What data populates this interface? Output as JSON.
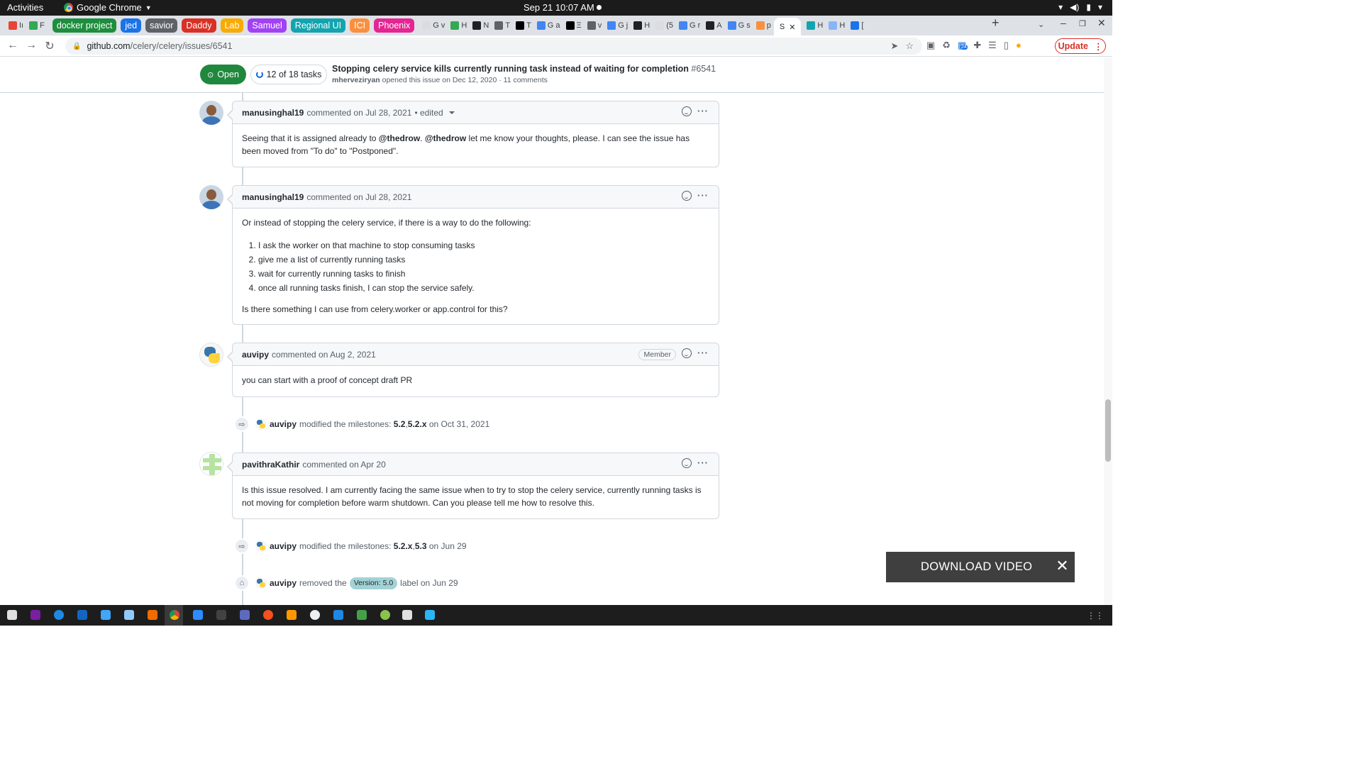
{
  "system": {
    "activities": "Activities",
    "app_name": "Google Chrome",
    "clock": "Sep 21  10:07 AM"
  },
  "tab_groups": [
    {
      "label": "docker project",
      "color": "#1e8e3e"
    },
    {
      "label": "jed",
      "color": "#1a73e8"
    },
    {
      "label": "savior",
      "color": "#5f6368"
    },
    {
      "label": "Daddy",
      "color": "#d93025"
    },
    {
      "label": "Lab",
      "color": "#f9ab00"
    },
    {
      "label": "Samuel",
      "color": "#a142f4"
    },
    {
      "label": "Regional UI",
      "color": "#12a4af"
    },
    {
      "label": "ICI",
      "color": "#fa903e"
    },
    {
      "label": "Phoenix",
      "color": "#e52592"
    }
  ],
  "pre_tabs": [
    {
      "label": "Iı",
      "fav": "#ea4335"
    },
    {
      "label": "F",
      "fav": "#34a853"
    }
  ],
  "mini_tabs": [
    {
      "label": "G v",
      "fav": "#dadce0"
    },
    {
      "label": "H",
      "fav": "#34a853"
    },
    {
      "label": "N",
      "fav": "#202124"
    },
    {
      "label": "T",
      "fav": "#5f6368"
    },
    {
      "label": "T",
      "fav": "#000000"
    },
    {
      "label": "G a",
      "fav": "#4285f4"
    },
    {
      "label": "Ξ",
      "fav": "#000000"
    },
    {
      "label": "v",
      "fav": "#5f6368"
    },
    {
      "label": "G j",
      "fav": "#4285f4"
    },
    {
      "label": "H",
      "fav": "#202124"
    },
    {
      "label": "(5",
      "fav": "#dadce0"
    },
    {
      "label": "G r",
      "fav": "#4285f4"
    },
    {
      "label": "A",
      "fav": "#202124"
    },
    {
      "label": "G s",
      "fav": "#4285f4"
    },
    {
      "label": "p",
      "fav": "#fa903e"
    }
  ],
  "active_tab": {
    "label": "S",
    "close": "✕"
  },
  "post_tabs": [
    {
      "label": "H",
      "fav": "#12a4af"
    },
    {
      "label": "H",
      "fav": "#8ab4f8"
    },
    {
      "label": "[",
      "fav": "#1a73e8"
    }
  ],
  "browser": {
    "url_host": "github.com",
    "url_path": "/celery/celery/issues/6541",
    "update_label": "Update",
    "ext_badge": "24"
  },
  "issue": {
    "state": "Open",
    "tasks": "12 of 18 tasks",
    "title": "Stopping celery service kills currently running task instead of waiting for completion",
    "number": "#6541",
    "author": "mherveziryan",
    "meta": "opened this issue on Dec 12, 2020 · 11 comments"
  },
  "comments": [
    {
      "author": "manusinghal19",
      "action": "commented on Jul 28, 2021",
      "edited": "• edited",
      "body_pre": "Seeing that it is assigned already to ",
      "mention1": "@thedrow",
      "mid": ". ",
      "mention2": "@thedrow",
      "body_post": " let me know your thoughts, please. I can see the issue has been moved from \"To do\" to \"Postponed\"."
    },
    {
      "author": "manusinghal19",
      "action": "commented on Jul 28, 2021",
      "intro": "Or instead of stopping the celery service, if there is a way to do the following:",
      "items": [
        "I ask the worker on that machine to stop consuming tasks",
        "give me a list of currently running tasks",
        "wait for currently running tasks to finish",
        "once all running tasks finish, I can stop the service safely."
      ],
      "outro": "Is there something I can use from celery.worker or app.control for this?"
    },
    {
      "author": "auvipy",
      "action": "commented on Aug 2, 2021",
      "badge": "Member",
      "body": "you can start with a proof of concept draft PR"
    },
    {
      "author": "pavithraKathir",
      "action": "commented on Apr 20",
      "body": "Is this issue resolved. I am currently facing the same issue when to try to stop the celery service, currently running tasks is not moving for completion before warm shutdown. Can you please tell me how to resolve this."
    }
  ],
  "events": [
    {
      "actor": "auvipy",
      "text": "modified the milestones:",
      "m1": "5.2",
      "sep": ", ",
      "m2": "5.2.x",
      "date": "on Oct 31, 2021"
    },
    {
      "actor": "auvipy",
      "text": "modified the milestones:",
      "m1": "5.2.x",
      "sep": ", ",
      "m2": "5.3",
      "date": "on Jun 29"
    },
    {
      "actor": "auvipy",
      "text": "removed the",
      "label": "Version: 5.0",
      "date": "label on Jun 29"
    }
  ],
  "overlay": {
    "label": "DOWNLOAD VIDEO",
    "close": "✕"
  }
}
